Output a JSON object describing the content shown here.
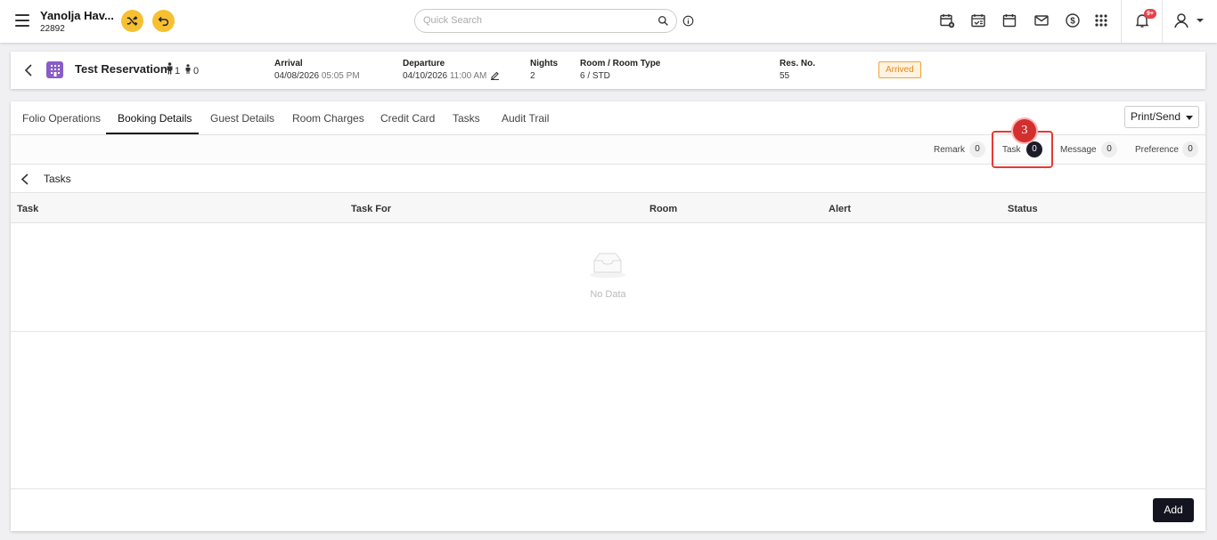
{
  "topbar": {
    "hotel_name": "Yanolja Hav...",
    "hotel_id": "22892",
    "search_placeholder": "Quick Search",
    "notification_count": "9+",
    "icons": [
      "calendar-add-icon",
      "calendar-check-icon",
      "calendar-icon",
      "mail-icon",
      "dollar-icon",
      "apps-grid-icon",
      "bell-icon",
      "user-icon"
    ],
    "accent_color": "#f6c031"
  },
  "reservation": {
    "title": "Test Reservation",
    "adults": "1",
    "children": "0",
    "arrival_label": "Arrival",
    "arrival_date": "04/08/2026",
    "arrival_time": "05:05 PM",
    "departure_label": "Departure",
    "departure_date": "04/10/2026",
    "departure_time": "11:00 AM",
    "nights_label": "Nights",
    "nights": "2",
    "room_label": "Room / Room Type",
    "room": "6 / STD",
    "resno_label": "Res. No.",
    "resno": "55",
    "status": "Arrived"
  },
  "tabs": [
    {
      "label": "Folio Operations"
    },
    {
      "label": "Booking Details"
    },
    {
      "label": "Guest Details"
    },
    {
      "label": "Room Charges"
    },
    {
      "label": "Credit Card"
    },
    {
      "label": "Tasks"
    },
    {
      "label": "Audit Trail"
    }
  ],
  "active_tab": "Booking Details",
  "print_send_label": "Print/Send",
  "subnav": {
    "remark_label": "Remark",
    "remark_count": "0",
    "task_label": "Task",
    "task_count": "0",
    "message_label": "Message",
    "message_count": "0",
    "preference_label": "Preference",
    "preference_count": "0",
    "step_number": "3"
  },
  "section": {
    "title": "Tasks"
  },
  "table": {
    "columns": [
      "Task",
      "Task For",
      "Room",
      "Alert",
      "Status"
    ],
    "empty_text": "No Data"
  },
  "add_label": "Add"
}
